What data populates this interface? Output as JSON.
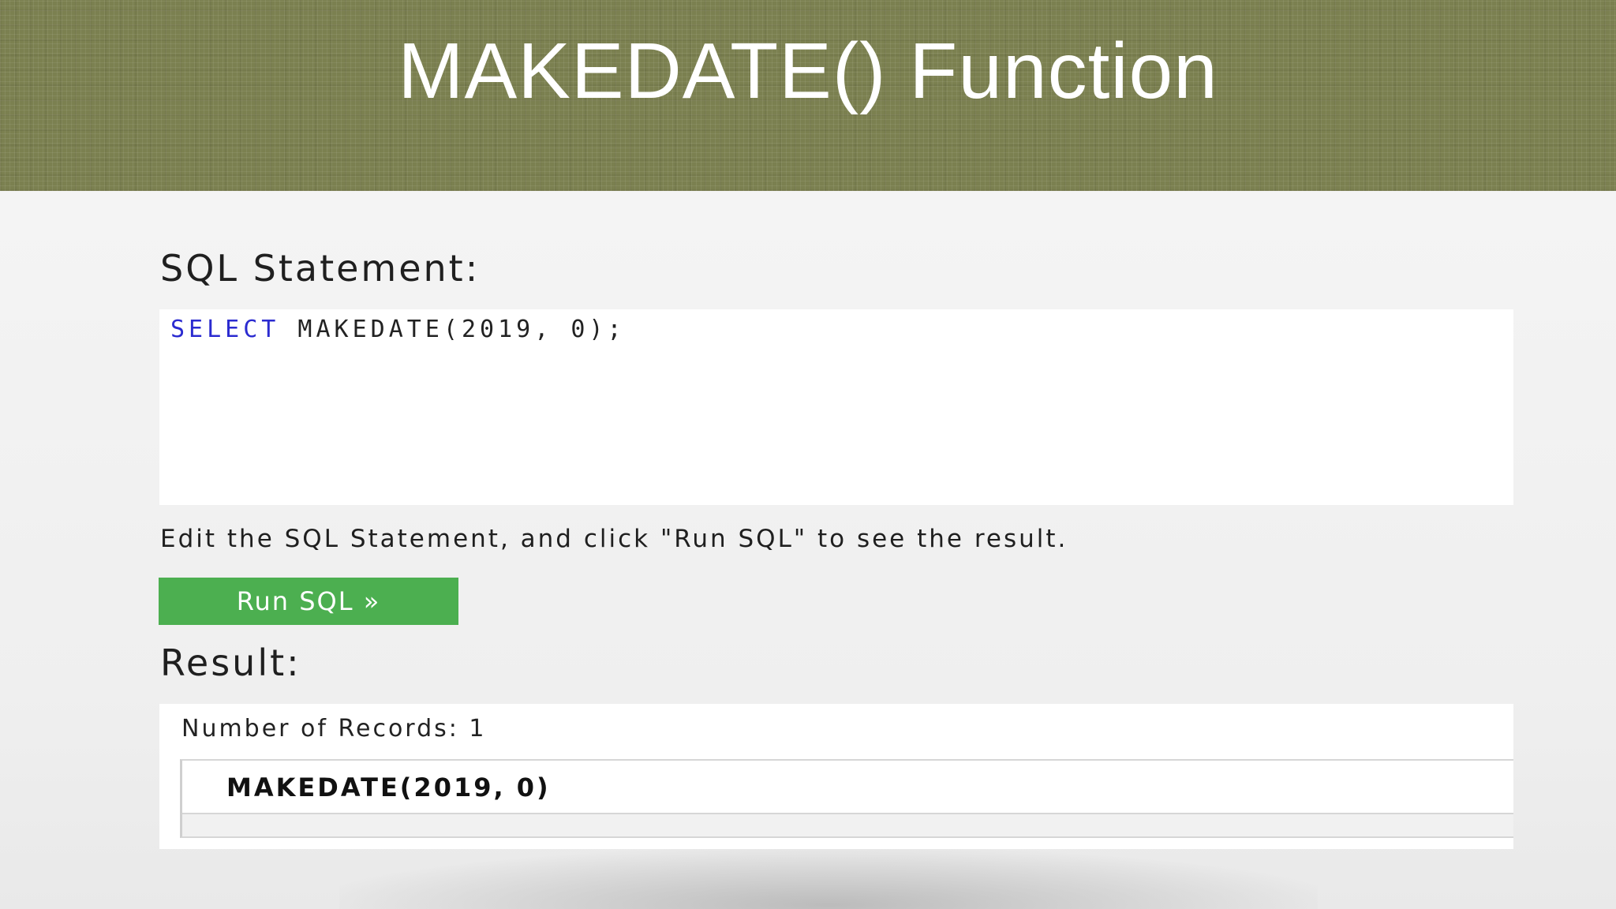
{
  "slide": {
    "title": "MAKEDATE() Function"
  },
  "editor_section": {
    "label": "SQL Statement:",
    "code_keyword": "SELECT",
    "code_rest": " MAKEDATE(2019, 0);",
    "hint": "Edit the SQL Statement, and click \"Run SQL\" to see the result.",
    "run_button_label": "Run SQL »"
  },
  "result_section": {
    "label": "Result:",
    "records_text": "Number of Records: 1",
    "columns": [
      "MAKEDATE(2019, 0)"
    ],
    "rows": [
      [
        ""
      ]
    ]
  },
  "colors": {
    "title_band": "#7b8050",
    "run_button": "#4caf50",
    "sql_keyword": "#2b2bd0"
  }
}
